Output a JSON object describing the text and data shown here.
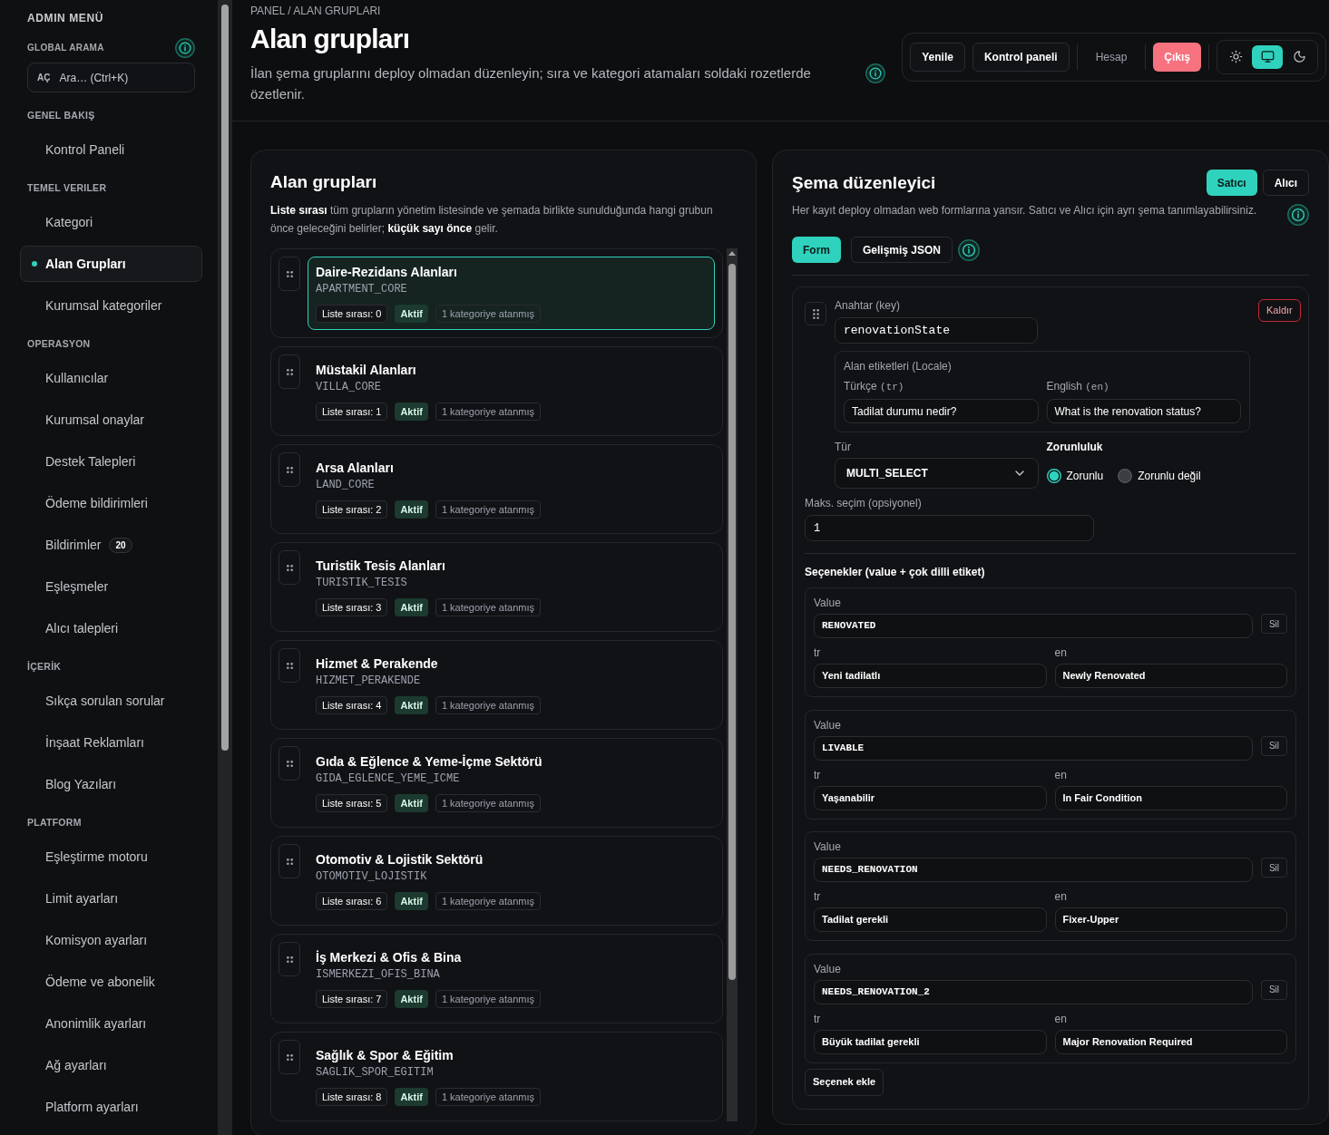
{
  "sidebar": {
    "title": "ADMIN MENÜ",
    "search_label": "GLOBAL ARAMA",
    "search": {
      "shortcut_label": "AÇ",
      "text": "Ara… (Ctrl+K)"
    },
    "sections": [
      {
        "title": "GENEL BAKIŞ",
        "items": [
          {
            "label": "Kontrol Paneli",
            "selected": false
          }
        ]
      },
      {
        "title": "TEMEL VERILER",
        "items": [
          {
            "label": "Kategori",
            "selected": false
          },
          {
            "label": "Alan Grupları",
            "selected": true
          },
          {
            "label": "Kurumsal kategoriler",
            "selected": false
          }
        ]
      },
      {
        "title": "OPERASYON",
        "items": [
          {
            "label": "Kullanıcılar",
            "selected": false
          },
          {
            "label": "Kurumsal onaylar",
            "selected": false
          },
          {
            "label": "Destek Talepleri",
            "selected": false
          },
          {
            "label": "Ödeme bildirimleri",
            "selected": false
          },
          {
            "label": "Bildirimler",
            "badge": "20",
            "selected": false
          },
          {
            "label": "Eşleşmeler",
            "selected": false
          },
          {
            "label": "Alıcı talepleri",
            "selected": false
          }
        ]
      },
      {
        "title": "İÇERİK",
        "items": [
          {
            "label": "Sıkça sorulan sorular",
            "selected": false
          },
          {
            "label": "İnşaat Reklamları",
            "selected": false
          },
          {
            "label": "Blog Yazıları",
            "selected": false
          }
        ]
      },
      {
        "title": "PLATFORM",
        "items": [
          {
            "label": "Eşleştirme motoru",
            "selected": false
          },
          {
            "label": "Limit ayarları",
            "selected": false
          },
          {
            "label": "Komisyon ayarları",
            "selected": false
          },
          {
            "label": "Ödeme ve abonelik",
            "selected": false
          },
          {
            "label": "Anonimlik ayarları",
            "selected": false
          },
          {
            "label": "Ağ ayarları",
            "selected": false
          },
          {
            "label": "Platform ayarları",
            "selected": false
          }
        ]
      }
    ]
  },
  "header": {
    "breadcrumb": "PANEL / ALAN GRUPLARI",
    "title": "Alan grupları",
    "description": "İlan şema gruplarını deploy olmadan düzenleyin; sıra ve kategori atamaları soldaki rozetlerde özetlenir.",
    "actions": [
      {
        "label": "Yenile",
        "kind": "outline"
      },
      {
        "label": "Kontrol paneli",
        "kind": "outline"
      },
      {
        "label": "Hesap",
        "kind": "ghost"
      },
      {
        "label": "Çıkış",
        "kind": "danger"
      }
    ],
    "theme_modes": [
      {
        "kind": "light",
        "selected": false
      },
      {
        "kind": "system",
        "selected": true
      },
      {
        "kind": "dark",
        "selected": false
      }
    ]
  },
  "left_panel": {
    "title": "Alan grupları",
    "description": "**Liste sırası** tüm grupların yönetim listesinde ve şemada birlikte sunulduğunda hangi grubun önce geleceğini belirler; **küçük sayı önce** gelir.",
    "groups": [
      {
        "name": "Daire-Rezidans Alanları",
        "code": "APARTMENT_CORE",
        "order": "Liste sırası: 0",
        "status": "Aktif",
        "categories": "1 kategoriye atanmış",
        "selected": true
      },
      {
        "name": "Müstakil Alanları",
        "code": "VILLA_CORE",
        "order": "Liste sırası: 1",
        "status": "Aktif",
        "categories": "1 kategoriye atanmış",
        "selected": false
      },
      {
        "name": "Arsa Alanları",
        "code": "LAND_CORE",
        "order": "Liste sırası: 2",
        "status": "Aktif",
        "categories": "1 kategoriye atanmış",
        "selected": false
      },
      {
        "name": "Turistik Tesis Alanları",
        "code": "TURISTIK_TESIS",
        "order": "Liste sırası: 3",
        "status": "Aktif",
        "categories": "1 kategoriye atanmış",
        "selected": false
      },
      {
        "name": "Hizmet & Perakende",
        "code": "HIZMET_PERAKENDE",
        "order": "Liste sırası: 4",
        "status": "Aktif",
        "categories": "1 kategoriye atanmış",
        "selected": false
      },
      {
        "name": "Gıda & Eğlence & Yeme-İçme Sektörü",
        "code": "GIDA_EGLENCE_YEME_ICME",
        "order": "Liste sırası: 5",
        "status": "Aktif",
        "categories": "1 kategoriye atanmış",
        "selected": false
      },
      {
        "name": "Otomotiv & Lojistik Sektörü",
        "code": "OTOMOTIV_LOJISTIK",
        "order": "Liste sırası: 6",
        "status": "Aktif",
        "categories": "1 kategoriye atanmış",
        "selected": false
      },
      {
        "name": "İş Merkezi & Ofis & Bina",
        "code": "ISMERKEZI_OFIS_BINA",
        "order": "Liste sırası: 7",
        "status": "Aktif",
        "categories": "1 kategoriye atanmış",
        "selected": false
      },
      {
        "name": "Sağlık & Spor & Eğitim",
        "code": "SAGLIK_SPOR_EGITIM",
        "order": "Liste sırası: 8",
        "status": "Aktif",
        "categories": "1 kategoriye atanmış",
        "selected": false
      }
    ]
  },
  "right_panel": {
    "title": "Şema düzenleyici",
    "audiences": [
      {
        "label": "Satıcı",
        "selected": true
      },
      {
        "label": "Alıcı",
        "selected": false
      }
    ],
    "description": "Her kayıt deploy olmadan web formlarına yansır. Satıcı ve Alıcı için ayrı şema tanımlayabilirsiniz.",
    "modes": [
      {
        "label": "Form",
        "selected": true
      },
      {
        "label": "Gelişmiş JSON",
        "selected": false
      }
    ],
    "field": {
      "key_label": "Anahtar (key)",
      "key": "renovationState",
      "remove": "Kaldır",
      "locale_title": "Alan etiketleri (Locale)",
      "locales": [
        {
          "label": "Türkçe",
          "code": "(tr)",
          "value": "Tadilat durumu nedir?"
        },
        {
          "label": "English",
          "code": "(en)",
          "value": "What is the renovation status?"
        }
      ],
      "type_label": "Tür",
      "type": "MULTI_SELECT",
      "required_label": "Zorunluluk",
      "required_options": [
        {
          "label": "Zorunlu",
          "selected": true
        },
        {
          "label": "Zorunlu değil",
          "selected": false
        }
      ],
      "max_label": "Maks. seçim (opsiyonel)",
      "max": "1",
      "options_title": "Seçenekler (value + çok dilli etiket)",
      "options": [
        {
          "value_label": "Value",
          "value": "RENOVATED",
          "delete": "Sil",
          "labels": [
            {
              "lang": "tr",
              "text": "Yeni tadilatlı"
            },
            {
              "lang": "en",
              "text": "Newly Renovated"
            }
          ]
        },
        {
          "value_label": "Value",
          "value": "LIVABLE",
          "delete": "Sil",
          "labels": [
            {
              "lang": "tr",
              "text": "Yaşanabilir"
            },
            {
              "lang": "en",
              "text": "In Fair Condition"
            }
          ]
        },
        {
          "value_label": "Value",
          "value": "NEEDS_RENOVATION",
          "delete": "Sil",
          "labels": [
            {
              "lang": "tr",
              "text": "Tadilat gerekli"
            },
            {
              "lang": "en",
              "text": "Fixer-Upper"
            }
          ]
        },
        {
          "value_label": "Value",
          "value": "NEEDS_RENOVATION_2",
          "delete": "Sil",
          "labels": [
            {
              "lang": "tr",
              "text": "Büyük tadilat gerekli"
            },
            {
              "lang": "en",
              "text": "Major Renovation Required"
            }
          ]
        }
      ],
      "add_option": "Seçenek ekle"
    }
  }
}
